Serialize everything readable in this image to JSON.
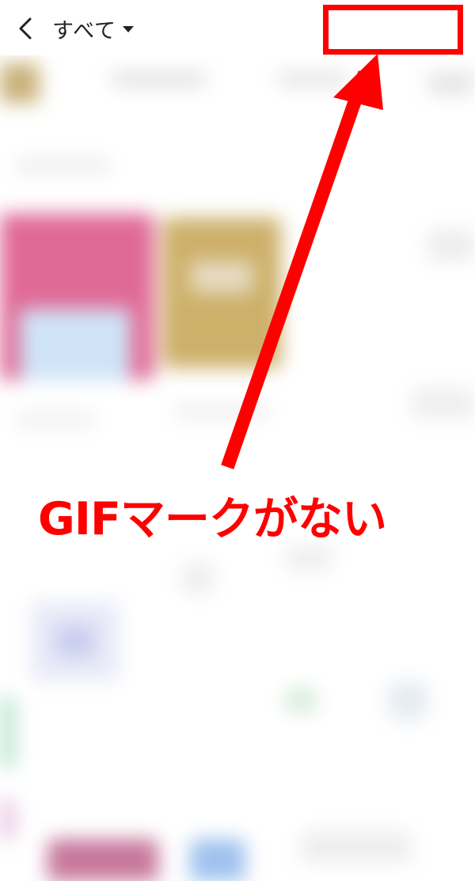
{
  "header": {
    "filter_label": "すべて"
  },
  "annotation": {
    "caption": "GIFマークがない",
    "color": "#ff0000"
  }
}
